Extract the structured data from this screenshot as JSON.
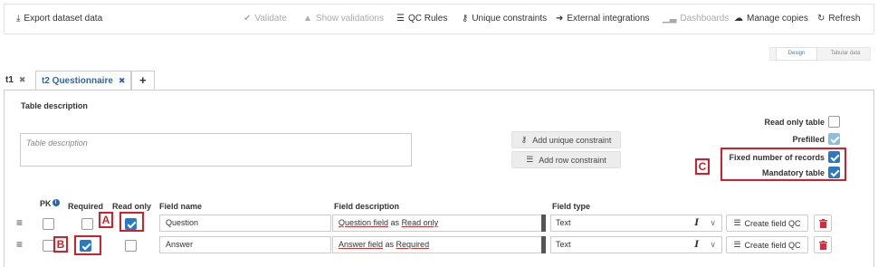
{
  "toolbar": {
    "export": "Export dataset data",
    "validate": "Validate",
    "show_validations": "Show validations",
    "qc_rules": "QC Rules",
    "unique_constraints": "Unique constraints",
    "external_integrations": "External integrations",
    "dashboards": "Dashboards",
    "manage_copies": "Manage copies",
    "refresh": "Refresh"
  },
  "view_toggle": {
    "design": "Design",
    "tabular": "Tabular data",
    "active": "Design"
  },
  "tabs": [
    {
      "label": "t1",
      "active": false
    },
    {
      "label": "t2 Questionnaire",
      "active": true
    }
  ],
  "add_tab_label": "+",
  "table_description": {
    "label": "Table description",
    "placeholder": "Table description"
  },
  "buttons": {
    "add_unique_constraint": "Add unique constraint",
    "add_row_constraint": "Add row constraint",
    "create_field_qc": "Create field QC"
  },
  "table_options": [
    {
      "label": "Read only table",
      "checked": false
    },
    {
      "label": "Prefilled",
      "checked": true
    },
    {
      "label": "Fixed number of records",
      "checked": true
    },
    {
      "label": "Mandatory table",
      "checked": true
    }
  ],
  "columns": {
    "pk": "PK",
    "required": "Required",
    "read_only": "Read only",
    "field_name": "Field name",
    "field_description": "Field description",
    "field_type": "Field type"
  },
  "fields": [
    {
      "name": "Question",
      "desc_a": "Question field",
      "desc_mid": " as ",
      "desc_b": "Read only",
      "type": "Text",
      "pk": false,
      "required": false,
      "read_only": true
    },
    {
      "name": "Answer",
      "desc_a": "Answer field",
      "desc_mid": " as ",
      "desc_b": "Required",
      "type": "Text",
      "pk": false,
      "required": true,
      "read_only": false
    }
  ],
  "annotations": {
    "a": "A",
    "b": "B",
    "c": "C"
  },
  "colors": {
    "accent": "#2a67b3",
    "annotation": "#d21f2a",
    "checkbox": "#2a79c4"
  }
}
